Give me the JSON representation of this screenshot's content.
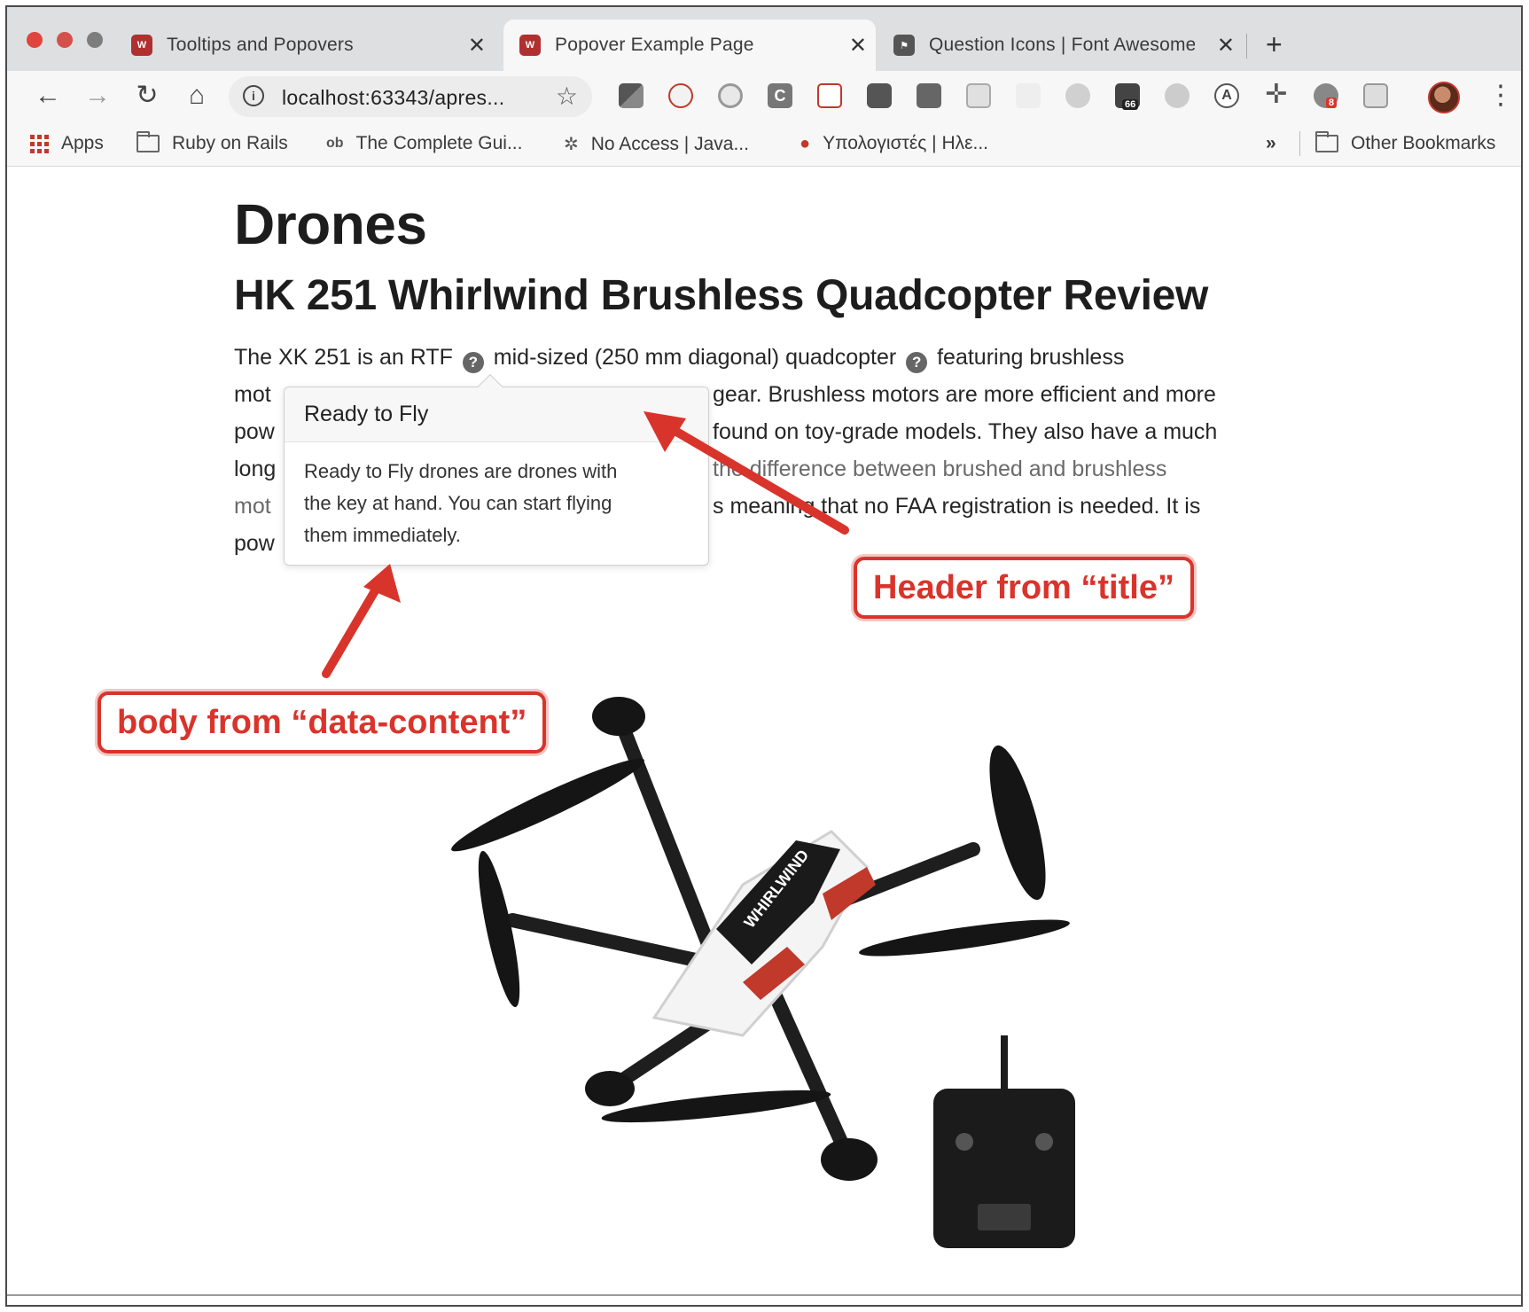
{
  "browser": {
    "tabs": [
      {
        "title": "Tooltips and Popovers",
        "active": false
      },
      {
        "title": "Popover Example Page",
        "active": true
      },
      {
        "title": "Question Icons | Font Awesome",
        "active": false
      }
    ],
    "url": "localhost:63343/apres...",
    "bookmarks": [
      {
        "label": "Apps",
        "icon": "apps-grid-icon"
      },
      {
        "label": "Ruby on Rails",
        "icon": "folder-icon"
      },
      {
        "label": "The Complete Gui...",
        "icon": "ob-icon"
      },
      {
        "label": "No Access | Java...",
        "icon": "network-icon"
      },
      {
        "label": "Υπολογιστές | Ηλε...",
        "icon": "shop-icon"
      }
    ],
    "bookmarks_overflow": "»",
    "other_bookmarks": "Other Bookmarks",
    "extension_badges": {
      "counter": "66",
      "alert": "8"
    }
  },
  "page": {
    "heading": "Drones",
    "article_title": "HK 251 Whirlwind Brushless Quadcopter Review",
    "paragraph": {
      "line1_a": "The XK 251 is an RTF",
      "line1_b": "mid-sized (250 mm diagonal) quadcopter",
      "line1_c": "featuring brushless",
      "line2_left": "mot",
      "line2_right": "gear. Brushless motors are more efficient and more",
      "line3_left": "pow",
      "line3_right": "found on toy-grade models. They also have a much",
      "line4_left": "long",
      "line4_right_link": "the difference between brushed and brushless",
      "line5_left_link": "mot",
      "line5_right": "s meaning that no FAA registration is needed. It is",
      "line6_left": "pow"
    },
    "question_icon": "?",
    "popover": {
      "header": "Ready to Fly",
      "body_lines": [
        "Ready to Fly drones are drones with",
        "the key at hand. You can start flying",
        "them immediately."
      ]
    },
    "drone_markings": "WHIRLWIND"
  },
  "annotations": {
    "header_callout": "Header from “title”",
    "body_callout": "body from “data-content”",
    "color": "#d9342b"
  }
}
